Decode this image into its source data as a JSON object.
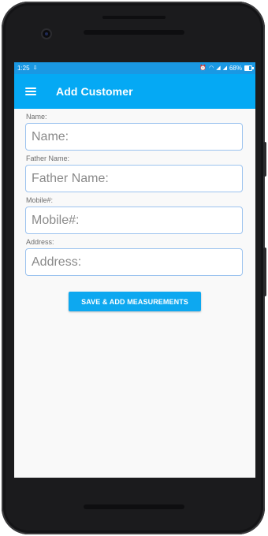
{
  "status_bar": {
    "time": "1:25",
    "battery_text": "68%"
  },
  "app_bar": {
    "menu_icon": "hamburger-menu-icon",
    "title": "Add Customer"
  },
  "form": {
    "fields": [
      {
        "label": "Name:",
        "placeholder": "Name:",
        "value": ""
      },
      {
        "label": "Father Name:",
        "placeholder": "Father Name:",
        "value": ""
      },
      {
        "label": "Mobile#:",
        "placeholder": "Mobile#:",
        "value": ""
      },
      {
        "label": "Address:",
        "placeholder": "Address:",
        "value": ""
      }
    ],
    "submit_label": "SAVE & ADD MEASUREMENTS"
  },
  "colors": {
    "status_bar": "#1a98e3",
    "app_bar": "#05a9f4",
    "button": "#0da8f0",
    "input_border": "#9cc3ef"
  }
}
